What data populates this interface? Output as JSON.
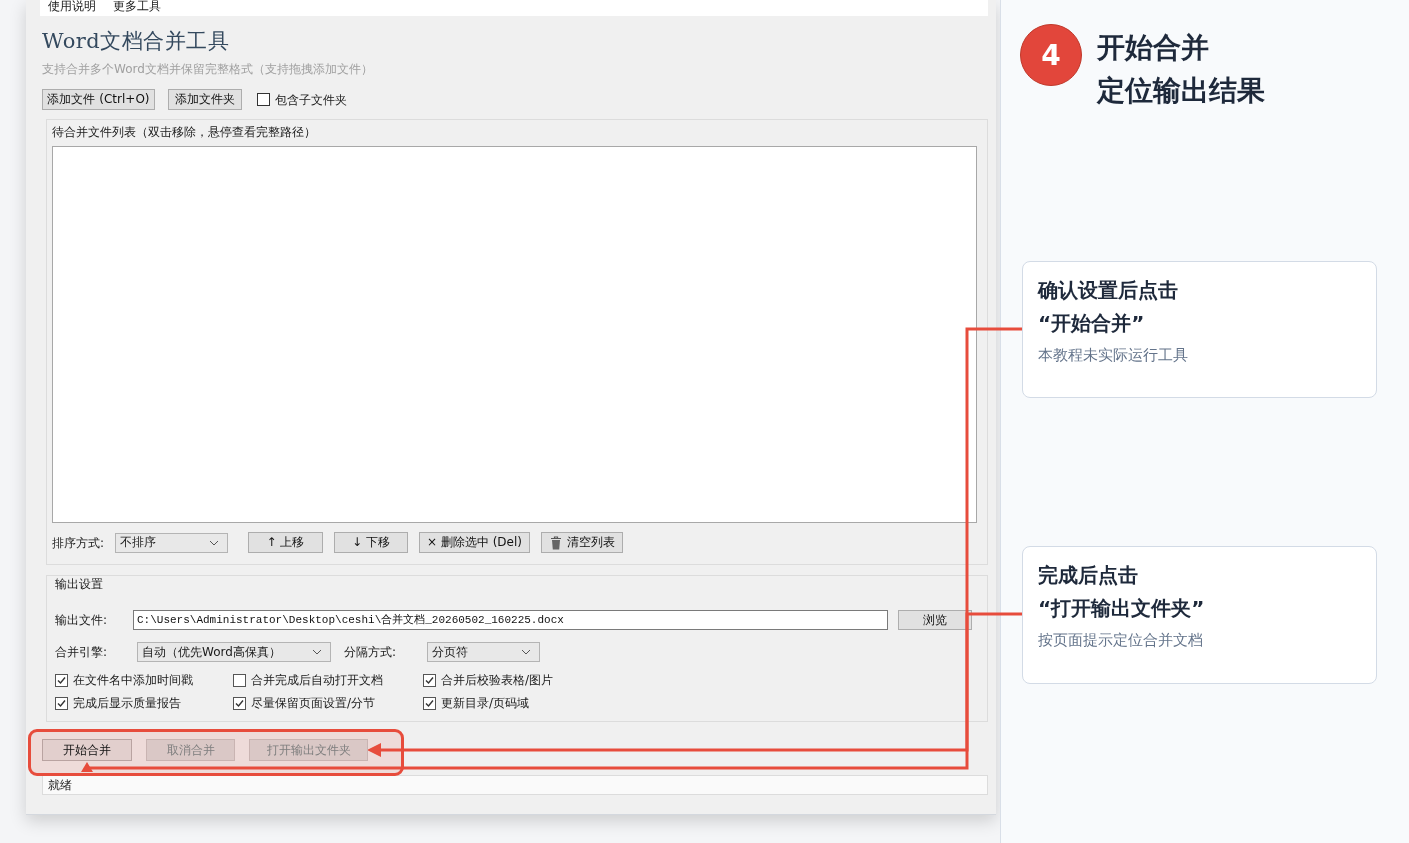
{
  "menu": [
    "使用说明",
    "更多工具"
  ],
  "app": {
    "title": "Word文档合并工具",
    "subtitle": "支持合并多个Word文档并保留完整格式（支持拖拽添加文件）"
  },
  "file_buttons": [
    "添加文件 (Ctrl+O)",
    "添加文件夹"
  ],
  "include_subfolders": {
    "label": "包含子文件夹",
    "checked": false
  },
  "file_list": {
    "title": "待合并文件列表（双击移除，悬停查看完整路径）"
  },
  "list_toolbar": {
    "sort_label": "排序方式:",
    "sort_value": "不排序",
    "buttons": [
      {
        "kind": "plain",
        "label": "↑ 上移"
      },
      {
        "kind": "plain",
        "label": "↓ 下移"
      },
      {
        "kind": "plain",
        "label": "× 删除选中 (Del)"
      },
      {
        "kind": "icon",
        "label": "清空列表"
      }
    ]
  },
  "output_settings": {
    "title": "输出设置",
    "file_label": "输出文件:",
    "file_path": "C:\\Users\\Administrator\\Desktop\\ceshi\\合并文档_20260502_160225.docx",
    "browse": "浏览",
    "engine_label": "合并引擎:",
    "engine_value": "自动（优先Word高保真）",
    "separator_label": "分隔方式:",
    "separator_value": "分页符",
    "options": [
      {
        "label": "在文件名中添加时间戳",
        "checked": true
      },
      {
        "label": "合并完成后自动打开文档",
        "checked": false
      },
      {
        "label": "合并后校验表格/图片",
        "checked": true
      },
      {
        "label": "完成后显示质量报告",
        "checked": true
      },
      {
        "label": "尽量保留页面设置/分节",
        "checked": true
      },
      {
        "label": "更新目录/页码域",
        "checked": true
      }
    ]
  },
  "action_buttons": {
    "highlighted": true,
    "items": [
      {
        "label": "开始合并",
        "disabled": false
      },
      {
        "label": "取消合并",
        "disabled": true
      },
      {
        "label": "打开输出文件夹",
        "disabled": true
      }
    ]
  },
  "status_bar": "就绪",
  "step": {
    "number": "4",
    "title_lines": [
      "开始合并",
      "定位输出结果"
    ]
  },
  "callouts": [
    {
      "title_lines": [
        "确认设置后点击",
        "“开始合并”"
      ],
      "note": "本教程未实际运行工具"
    },
    {
      "title_lines": [
        "完成后点击",
        "“打开输出文件夹”"
      ],
      "note": "按页面提示定位合并文档"
    }
  ]
}
